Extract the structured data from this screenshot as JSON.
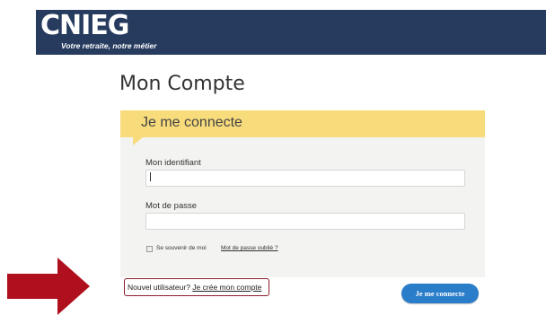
{
  "header": {
    "brand": "CNIEG",
    "tagline": "Votre retraite, notre métier",
    "color": "#263b5e"
  },
  "page": {
    "title": "Mon Compte"
  },
  "login_card": {
    "title": "Je me connecte",
    "header_color": "#f8dc7b",
    "identifier": {
      "label": "Mon identifiant",
      "value": ""
    },
    "password": {
      "label": "Mot de passe",
      "value": ""
    },
    "remember_me": {
      "label": "Se souvenir de moi",
      "checked": false
    },
    "forgot_password": "Mot de passe oublié ?"
  },
  "new_user": {
    "prefix": "Nouvel utilisateur? ",
    "link": "Je crée mon compte"
  },
  "submit": {
    "label": "Je me connecte",
    "color": "#2a7dc9"
  },
  "annotation": {
    "arrow_color": "#b0101e",
    "highlight_color": "#8b1c2a"
  }
}
